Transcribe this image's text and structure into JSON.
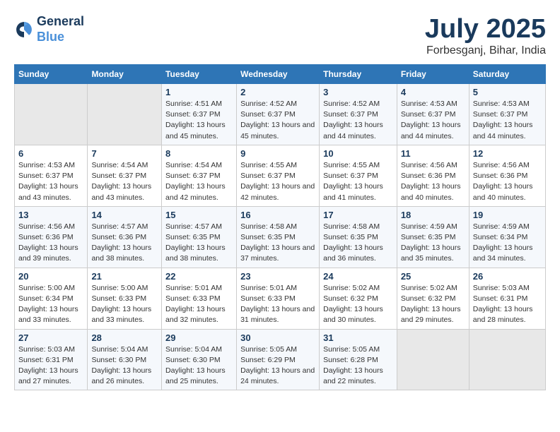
{
  "logo": {
    "line1": "General",
    "line2": "Blue"
  },
  "title": "July 2025",
  "subtitle": "Forbesganj, Bihar, India",
  "days_of_week": [
    "Sunday",
    "Monday",
    "Tuesday",
    "Wednesday",
    "Thursday",
    "Friday",
    "Saturday"
  ],
  "weeks": [
    [
      {
        "day": "",
        "sunrise": "",
        "sunset": "",
        "daylight": "",
        "empty": true
      },
      {
        "day": "",
        "sunrise": "",
        "sunset": "",
        "daylight": "",
        "empty": true
      },
      {
        "day": "1",
        "sunrise": "Sunrise: 4:51 AM",
        "sunset": "Sunset: 6:37 PM",
        "daylight": "Daylight: 13 hours and 45 minutes."
      },
      {
        "day": "2",
        "sunrise": "Sunrise: 4:52 AM",
        "sunset": "Sunset: 6:37 PM",
        "daylight": "Daylight: 13 hours and 45 minutes."
      },
      {
        "day": "3",
        "sunrise": "Sunrise: 4:52 AM",
        "sunset": "Sunset: 6:37 PM",
        "daylight": "Daylight: 13 hours and 44 minutes."
      },
      {
        "day": "4",
        "sunrise": "Sunrise: 4:53 AM",
        "sunset": "Sunset: 6:37 PM",
        "daylight": "Daylight: 13 hours and 44 minutes."
      },
      {
        "day": "5",
        "sunrise": "Sunrise: 4:53 AM",
        "sunset": "Sunset: 6:37 PM",
        "daylight": "Daylight: 13 hours and 44 minutes."
      }
    ],
    [
      {
        "day": "6",
        "sunrise": "Sunrise: 4:53 AM",
        "sunset": "Sunset: 6:37 PM",
        "daylight": "Daylight: 13 hours and 43 minutes."
      },
      {
        "day": "7",
        "sunrise": "Sunrise: 4:54 AM",
        "sunset": "Sunset: 6:37 PM",
        "daylight": "Daylight: 13 hours and 43 minutes."
      },
      {
        "day": "8",
        "sunrise": "Sunrise: 4:54 AM",
        "sunset": "Sunset: 6:37 PM",
        "daylight": "Daylight: 13 hours and 42 minutes."
      },
      {
        "day": "9",
        "sunrise": "Sunrise: 4:55 AM",
        "sunset": "Sunset: 6:37 PM",
        "daylight": "Daylight: 13 hours and 42 minutes."
      },
      {
        "day": "10",
        "sunrise": "Sunrise: 4:55 AM",
        "sunset": "Sunset: 6:37 PM",
        "daylight": "Daylight: 13 hours and 41 minutes."
      },
      {
        "day": "11",
        "sunrise": "Sunrise: 4:56 AM",
        "sunset": "Sunset: 6:36 PM",
        "daylight": "Daylight: 13 hours and 40 minutes."
      },
      {
        "day": "12",
        "sunrise": "Sunrise: 4:56 AM",
        "sunset": "Sunset: 6:36 PM",
        "daylight": "Daylight: 13 hours and 40 minutes."
      }
    ],
    [
      {
        "day": "13",
        "sunrise": "Sunrise: 4:56 AM",
        "sunset": "Sunset: 6:36 PM",
        "daylight": "Daylight: 13 hours and 39 minutes."
      },
      {
        "day": "14",
        "sunrise": "Sunrise: 4:57 AM",
        "sunset": "Sunset: 6:36 PM",
        "daylight": "Daylight: 13 hours and 38 minutes."
      },
      {
        "day": "15",
        "sunrise": "Sunrise: 4:57 AM",
        "sunset": "Sunset: 6:35 PM",
        "daylight": "Daylight: 13 hours and 38 minutes."
      },
      {
        "day": "16",
        "sunrise": "Sunrise: 4:58 AM",
        "sunset": "Sunset: 6:35 PM",
        "daylight": "Daylight: 13 hours and 37 minutes."
      },
      {
        "day": "17",
        "sunrise": "Sunrise: 4:58 AM",
        "sunset": "Sunset: 6:35 PM",
        "daylight": "Daylight: 13 hours and 36 minutes."
      },
      {
        "day": "18",
        "sunrise": "Sunrise: 4:59 AM",
        "sunset": "Sunset: 6:35 PM",
        "daylight": "Daylight: 13 hours and 35 minutes."
      },
      {
        "day": "19",
        "sunrise": "Sunrise: 4:59 AM",
        "sunset": "Sunset: 6:34 PM",
        "daylight": "Daylight: 13 hours and 34 minutes."
      }
    ],
    [
      {
        "day": "20",
        "sunrise": "Sunrise: 5:00 AM",
        "sunset": "Sunset: 6:34 PM",
        "daylight": "Daylight: 13 hours and 33 minutes."
      },
      {
        "day": "21",
        "sunrise": "Sunrise: 5:00 AM",
        "sunset": "Sunset: 6:33 PM",
        "daylight": "Daylight: 13 hours and 33 minutes."
      },
      {
        "day": "22",
        "sunrise": "Sunrise: 5:01 AM",
        "sunset": "Sunset: 6:33 PM",
        "daylight": "Daylight: 13 hours and 32 minutes."
      },
      {
        "day": "23",
        "sunrise": "Sunrise: 5:01 AM",
        "sunset": "Sunset: 6:33 PM",
        "daylight": "Daylight: 13 hours and 31 minutes."
      },
      {
        "day": "24",
        "sunrise": "Sunrise: 5:02 AM",
        "sunset": "Sunset: 6:32 PM",
        "daylight": "Daylight: 13 hours and 30 minutes."
      },
      {
        "day": "25",
        "sunrise": "Sunrise: 5:02 AM",
        "sunset": "Sunset: 6:32 PM",
        "daylight": "Daylight: 13 hours and 29 minutes."
      },
      {
        "day": "26",
        "sunrise": "Sunrise: 5:03 AM",
        "sunset": "Sunset: 6:31 PM",
        "daylight": "Daylight: 13 hours and 28 minutes."
      }
    ],
    [
      {
        "day": "27",
        "sunrise": "Sunrise: 5:03 AM",
        "sunset": "Sunset: 6:31 PM",
        "daylight": "Daylight: 13 hours and 27 minutes."
      },
      {
        "day": "28",
        "sunrise": "Sunrise: 5:04 AM",
        "sunset": "Sunset: 6:30 PM",
        "daylight": "Daylight: 13 hours and 26 minutes."
      },
      {
        "day": "29",
        "sunrise": "Sunrise: 5:04 AM",
        "sunset": "Sunset: 6:30 PM",
        "daylight": "Daylight: 13 hours and 25 minutes."
      },
      {
        "day": "30",
        "sunrise": "Sunrise: 5:05 AM",
        "sunset": "Sunset: 6:29 PM",
        "daylight": "Daylight: 13 hours and 24 minutes."
      },
      {
        "day": "31",
        "sunrise": "Sunrise: 5:05 AM",
        "sunset": "Sunset: 6:28 PM",
        "daylight": "Daylight: 13 hours and 22 minutes."
      },
      {
        "day": "",
        "sunrise": "",
        "sunset": "",
        "daylight": "",
        "empty": true
      },
      {
        "day": "",
        "sunrise": "",
        "sunset": "",
        "daylight": "",
        "empty": true
      }
    ]
  ]
}
